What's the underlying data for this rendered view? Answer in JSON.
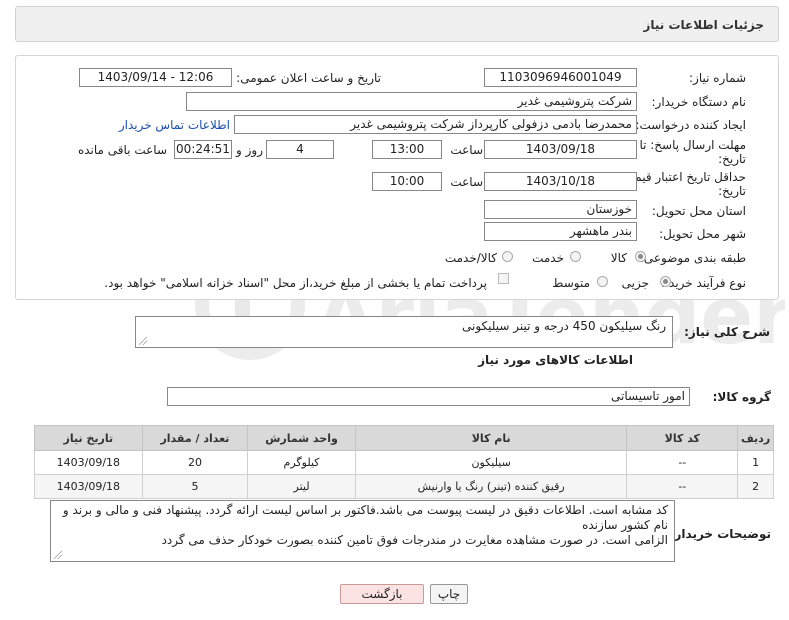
{
  "panel": {
    "title": "جزئیات اطلاعات نیاز"
  },
  "form": {
    "need_number_label": "شماره نیاز:",
    "need_number": "1103096946001049",
    "announce_label": "تاریخ و ساعت اعلان عمومی:",
    "announce_value": "1403/09/14 - 12:06",
    "buyer_org_label": "نام دستگاه خریدار:",
    "buyer_org": "شرکت پتروشیمی غدیر",
    "creator_label": "ایجاد کننده درخواست:",
    "creator": "محمدرضا بادمی دزفولی کارپرداز شرکت پتروشیمی غدیر",
    "contact_link": "اطلاعات تماس خریدار",
    "deadline_label": "مهلت ارسال پاسخ: تا",
    "deadline_label2": "تاریخ:",
    "deadline_date": "1403/09/18",
    "time_label": "ساعت",
    "deadline_time": "13:00",
    "days_value": "4",
    "days_label": "روز و",
    "remaining_value": "00:24:51",
    "remaining_label": "ساعت باقی مانده",
    "validity_label": "حداقل تاریخ اعتبار قیمت: تا",
    "validity_label2": "تاریخ:",
    "validity_date": "1403/10/18",
    "validity_time": "10:00",
    "province_label": "استان محل تحویل:",
    "province": "خوزستان",
    "city_label": "شهر محل تحویل:",
    "city": "بندر ماهشهر",
    "category_label": "طبقه بندی موضوعی:",
    "category_options": [
      "کالا",
      "خدمت",
      "کالا/خدمت"
    ],
    "process_label": "نوع فرآیند خرید :",
    "process_options": [
      "جزیی",
      "متوسط"
    ],
    "payment_note": "پرداخت تمام یا بخشی از مبلغ خرید،از محل \"اسناد خزانه اسلامی\" خواهد بود."
  },
  "description": {
    "label": "شرح کلی نیاز:",
    "value": "رنگ سیلیکون 450 درجه و تینر سیلیکونی"
  },
  "goods": {
    "section_title": "اطلاعات کالاهای مورد نیاز",
    "group_label": "گروه کالا:",
    "group_value": "امور تاسیساتی",
    "columns": [
      "ردیف",
      "کد کالا",
      "نام کالا",
      "واحد شمارش",
      "تعداد / مقدار",
      "تاریخ نیاز"
    ],
    "rows": [
      [
        "1",
        "--",
        "سیلیکون",
        "کیلوگرم",
        "20",
        "1403/09/18"
      ],
      [
        "2",
        "--",
        "رقیق کننده (تینر) رنگ یا وارنیش",
        "لیتر",
        "5",
        "1403/09/18"
      ]
    ]
  },
  "notes": {
    "label": "توضیحات خریدار:",
    "line1": "کد مشابه است. اطلاعات دقیق در لیست پیوست می باشد.فاکتور بر اساس لیست ارائه گردد. پیشنهاد فنی و مالی و برند و",
    "line2": "نام کشور سازنده",
    "line3": "الزامی است. در صورت مشاهده مغایرت در مندرجات فوق تامین کننده بصورت خودکار حذف می گردد"
  },
  "buttons": {
    "print": "چاپ",
    "back": "بازگشت"
  },
  "colors": {
    "link": "#1a4fb0",
    "back_bg": "#fbe3e3",
    "header_bg": "#d9d9d9"
  }
}
